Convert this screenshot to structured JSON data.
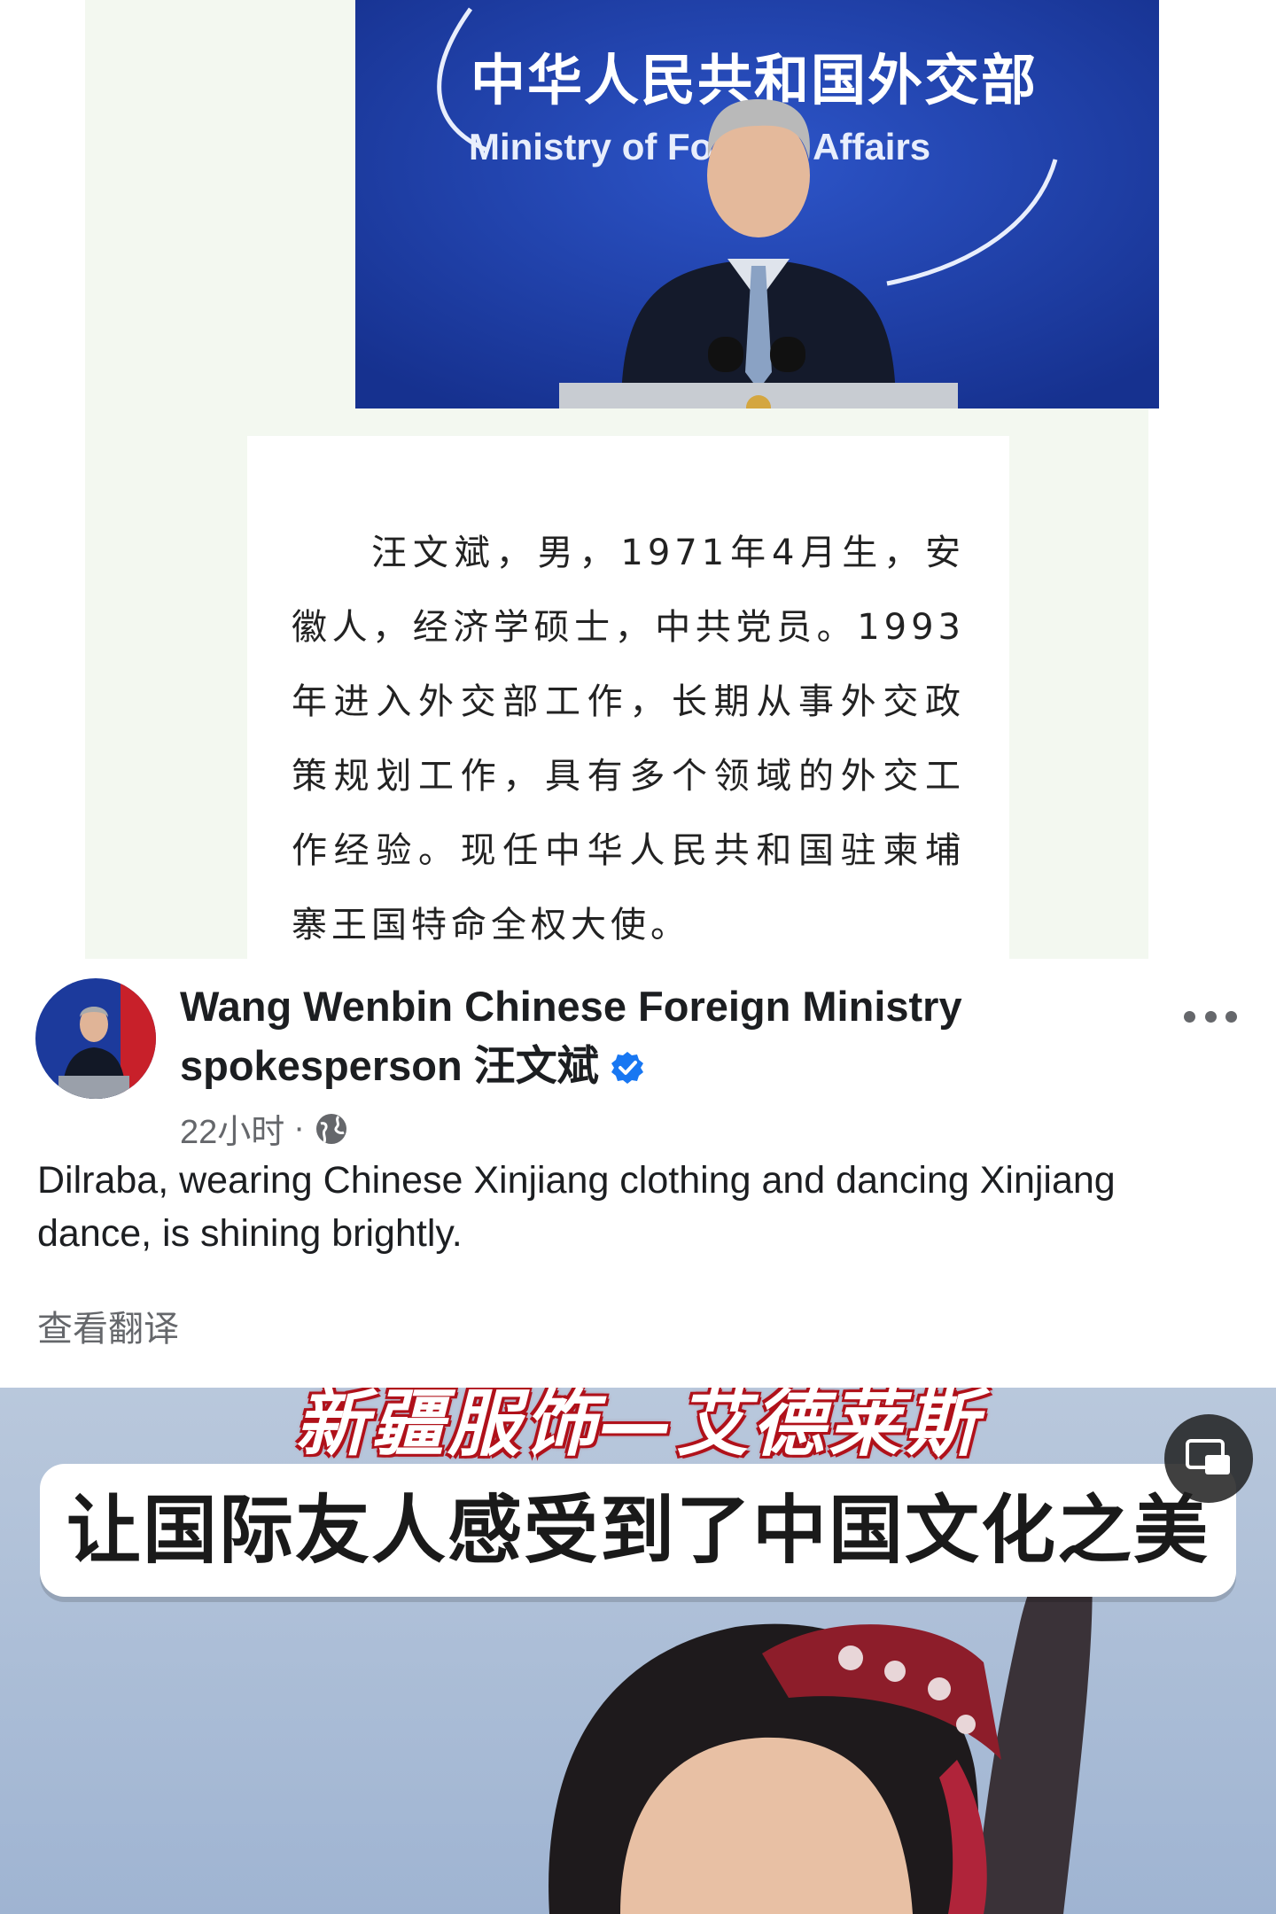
{
  "article": {
    "photo_logo_cn": "中华人民共和国外交部",
    "photo_logo_en": "Ministry of Foreign Affairs",
    "bio": "汪文斌，男，1971年4月生，安徽人，经济学硕士，中共党员。1993年进入外交部工作，长期从事外交政策规划工作，具有多个领域的外交工作经验。现任中华人民共和国驻柬埔寨王国特命全权大使。"
  },
  "post": {
    "author": "Wang Wenbin Chinese Foreign Ministry spokesperson 汪文斌",
    "verified_icon": "verified-badge-icon",
    "more_icon": "more-options-icon",
    "time": "22小时",
    "separator": "·",
    "audience_icon": "globe-icon",
    "text": "Dilraba, wearing Chinese Xinjiang clothing and dancing Xinjiang dance, is shining brightly.",
    "translate_label": "查看翻译"
  },
  "video": {
    "top_caption": "新疆服饰—艾德莱斯",
    "subtitle": "让国际友人感受到了中国文化之美",
    "pip_icon": "picture-in-picture-icon"
  },
  "colors": {
    "photo_background": "#1f3fa8",
    "card_background": "#f3f8f0",
    "verified_blue": "#1877f2",
    "meta_gray": "#65676b",
    "caption_red": "#b0121b"
  }
}
